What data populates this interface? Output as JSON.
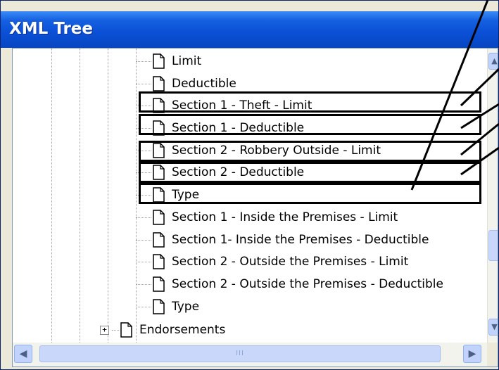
{
  "window": {
    "title": "XML Tree"
  },
  "tree": {
    "items": [
      {
        "label": "Limit"
      },
      {
        "label": "Deductible"
      },
      {
        "label": "Section 1 - Theft - Limit"
      },
      {
        "label": "Section 1 - Deductible"
      },
      {
        "label": "Section 2 - Robbery Outside - Limit"
      },
      {
        "label": "Section 2 - Deductible"
      },
      {
        "label": "Type"
      },
      {
        "label": "Section 1 - Inside the Premises - Limit"
      },
      {
        "label": "Section 1- Inside the Premises - Deductible"
      },
      {
        "label": "Section 2 - Outside the Premises - Limit"
      },
      {
        "label": "Section 2 - Outside the Premises - Deductible"
      },
      {
        "label": "Type"
      }
    ],
    "parent_item": {
      "label": "Endorsements",
      "expand_glyph": "+"
    }
  },
  "scrollbars": {
    "up_arrow": "▲",
    "down_arrow": "▼",
    "left_arrow": "◀",
    "right_arrow": "▶",
    "thumb_grip": "III"
  },
  "colors": {
    "title_bar": "#0a4fd6",
    "title_text": "#ffffff",
    "highlight_box": "#000000"
  }
}
